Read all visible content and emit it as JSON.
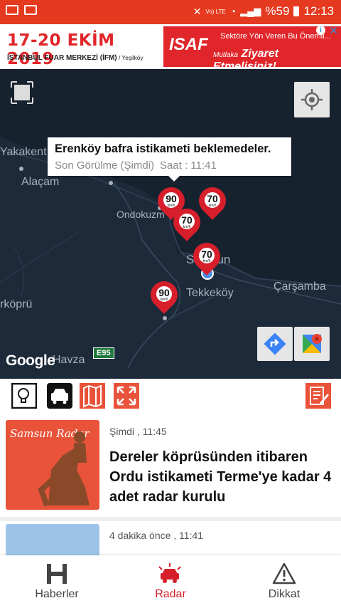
{
  "status_bar": {
    "battery": "%59",
    "time": "12:13",
    "network": "Vo) LTE"
  },
  "ad": {
    "date": "17-20 EKİM 2019",
    "venue": "İSTANBUL FUAR MERKEZİ (İFM)",
    "venue_sub": " / Yeşilköy",
    "brand": "ISAF",
    "line1": "Sektöre Yön Veren Bu Önemli...",
    "line2_small": "Mutlaka",
    "line2": "Ziyaret Etmelisiniz!"
  },
  "map": {
    "places": [
      "Yakakent",
      "Alaçam",
      "Ondokuzm",
      "Samsun",
      "Tekkeköy",
      "Çarşamba",
      "rköprü",
      "Havza"
    ],
    "road_shield": "E95",
    "google_logo": "Google",
    "tooltip": {
      "title": "Erenköy bafra istikameti beklemedeler.",
      "seen": "Son Görülme (Şimdi)",
      "time": "Saat : 11:41"
    },
    "markers": [
      {
        "speed": "90",
        "unit": "km/h"
      },
      {
        "speed": "70",
        "unit": "km/h"
      },
      {
        "speed": "70",
        "unit": "km/h"
      },
      {
        "speed": "70",
        "unit": "km/h"
      },
      {
        "speed": "90",
        "unit": "km/h"
      }
    ]
  },
  "news": [
    {
      "time": "Şimdi , 11:45",
      "title": "Dereler köprüsünden itibaren Ordu  istikameti Terme'ye kadar 4 adet radar kurulu",
      "thumb_brand": "Samsun Radar"
    },
    {
      "time": "4 dakika önce , 11:41",
      "title": ""
    }
  ],
  "nav": {
    "news": "Haberler",
    "radar": "Radar",
    "alert": "Dikkat"
  },
  "colors": {
    "accent": "#d61f2a",
    "statusbar": "#e53a1f",
    "map_bg": "#1d2a3a"
  }
}
